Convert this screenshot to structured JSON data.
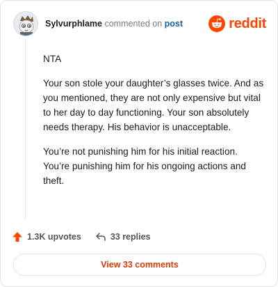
{
  "header": {
    "username": "Sylvurphlame",
    "action": "commented on",
    "post_link": "post",
    "brand": "reddit"
  },
  "comment": {
    "paragraphs": [
      "NTA",
      "Your son stole your daughter’s glasses twice. And as you mentioned, they are not only expensive but vital to her day to day functioning. Your son absolutely needs therapy. His behavior is unacceptable.",
      "You’re not punishing him for his initial reaction. You’re punishing him for his ongoing actions and theft."
    ]
  },
  "footer": {
    "upvotes": "1.3K upvotes",
    "replies": "33 replies",
    "upvote_icon": "upvote-arrow-icon",
    "reply_icon": "reply-arrow-icon"
  },
  "view_button": {
    "label": "View 33 comments"
  },
  "colors": {
    "brand": "#ff4500",
    "link": "#1a5ea8",
    "upvote": "#ff4500",
    "button_text": "#d93a00"
  }
}
